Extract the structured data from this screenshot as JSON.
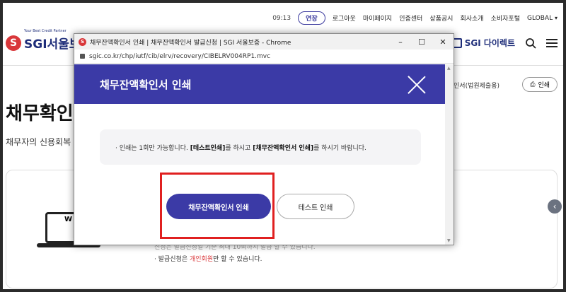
{
  "util": {
    "time": "09:13",
    "extend": "연장",
    "links": [
      "로그아웃",
      "마이페이지",
      "인증센터",
      "상품공시",
      "회사소개",
      "소비자포털",
      "GLOBAL"
    ]
  },
  "header": {
    "logo_tag": "Your Best Credit Partner",
    "logo_text": "SGI서울보",
    "direct": "SGI 다이렉트"
  },
  "page": {
    "breadcrumb": "채무확인서(법원제출용)",
    "print_label": "인쇄",
    "title": "채무확인",
    "desc": "채무자의 신용회복",
    "note1": "신청은 발급신청일 기준 최대 10회까지 발급 할 수 있습니다.",
    "note2_pre": "발급신청은 ",
    "note2_red": "개인회원",
    "note2_post": "만 할 수 있습니다."
  },
  "popup": {
    "window_title": "채무잔액확인서 인쇄 | 채무잔액확인서 발급신청 | SGI 서울보증 - Chrome",
    "url": "sgic.co.kr/chp/iutf/cib/elrv/recovery/CIBELRV004RP1.mvc",
    "heading": "채무잔액확인서 인쇄",
    "info_pre": "· 인쇄는 1회만 가능합니다. ",
    "info_b1": "[테스트인쇄]",
    "info_mid": "를 하시고 ",
    "info_b2": "[채무잔액확인서 인쇄]",
    "info_post": "를 하시기 바랍니다.",
    "print_button": "채무잔액확인서 인쇄",
    "test_button": "테스트 인쇄"
  }
}
